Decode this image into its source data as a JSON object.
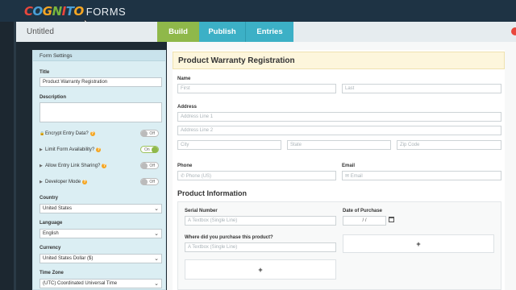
{
  "app": {
    "logo_letters": [
      "C",
      "O",
      "G",
      "N",
      "I",
      "T",
      "O"
    ],
    "logo_forms": "FORMS",
    "form_name": "Untitled"
  },
  "tabs": [
    {
      "label": "Build"
    },
    {
      "label": "Publish"
    },
    {
      "label": "Entries"
    }
  ],
  "settings": {
    "header": "Form Settings",
    "title_label": "Title",
    "title_value": "Product Warranty Registration",
    "description_label": "Description",
    "toggles": [
      {
        "label": "Encrypt Entry Data?",
        "state": "Off"
      },
      {
        "label": "Limit Form Availability?",
        "state": "On"
      },
      {
        "label": "Allow Entry Link Sharing?",
        "state": "Off"
      },
      {
        "label": "Developer Mode",
        "state": "Off"
      }
    ],
    "country_label": "Country",
    "country_value": "United States",
    "language_label": "Language",
    "language_value": "English",
    "currency_label": "Currency",
    "currency_value": "United States Dollar ($)",
    "timezone_label": "Time Zone",
    "timezone_value": "(UTC) Coordinated Universal Time"
  },
  "form": {
    "title": "Product Warranty Registration",
    "name_label": "Name",
    "first_placeholder": "First",
    "last_placeholder": "Last",
    "address_label": "Address",
    "address1_placeholder": "Address Line 1",
    "address2_placeholder": "Address Line 2",
    "city_placeholder": "City",
    "state_placeholder": "State",
    "zip_placeholder": "Zip Code",
    "phone_label": "Phone",
    "phone_placeholder": "Phone (US)",
    "email_label": "Email",
    "email_placeholder": "Email",
    "section_title": "Product Information",
    "serial_label": "Serial Number",
    "serial_placeholder": "Textbox (Single Line)",
    "date_label": "Date of Purchase",
    "date_placeholder": "/ /",
    "where_label": "Where did you purchase this product?",
    "where_placeholder": "Textbox (Single Line)",
    "add_symbol": "+"
  },
  "colors": {
    "build_tab": "#8fb84a",
    "other_tabs": "#3cb0c6",
    "topbar": "#1e3344",
    "settings_bg": "#dbeef3",
    "title_bar": "#fdf6dc"
  }
}
